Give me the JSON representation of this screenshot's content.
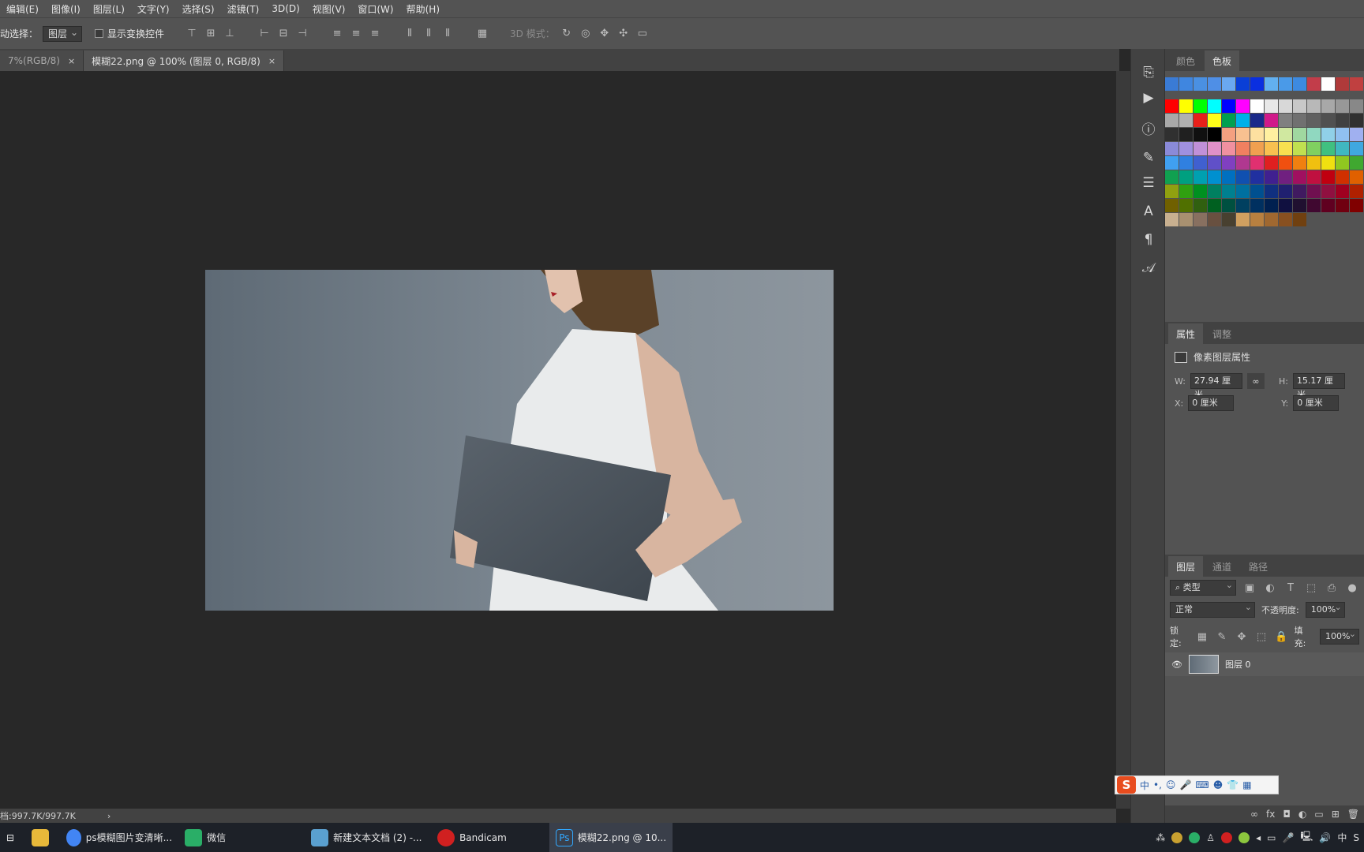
{
  "menu": [
    "编辑(E)",
    "图像(I)",
    "图层(L)",
    "文字(Y)",
    "选择(S)",
    "滤镜(T)",
    "3D(D)",
    "视图(V)",
    "窗口(W)",
    "帮助(H)"
  ],
  "options": {
    "auto_select_label": "动选择：",
    "auto_select_value": "图层",
    "show_transform_label": "显示变换控件",
    "mode_3d_label": "3D 模式："
  },
  "tabs": [
    {
      "label": "7%(RGB/8)",
      "close": "×"
    },
    {
      "label": "模糊22.png @ 100% (图层 0, RGB/8)",
      "close": "×"
    }
  ],
  "swatch_tabs": [
    "颜色",
    "色板"
  ],
  "swatches": [
    [
      "#3a7bd5",
      "#3f86e0",
      "#4a90e2",
      "#4f8fe6",
      "#6aa8f0",
      "#0a3fd6",
      "#0a2fe0",
      "#62b0f0",
      "#4a9ae8",
      "#3d8ae0",
      "#c23d4a",
      "#ffffff",
      "#b03a3a",
      "#c04040"
    ],
    [
      "#ff0000",
      "#ffff00",
      "#00ff00",
      "#00ffff",
      "#0000ff",
      "#ff00ff",
      "#ffffff",
      "#e8e8e8",
      "#d8d8d8",
      "#c8c8c8",
      "#b8b8b8",
      "#a8a8a8",
      "#989898",
      "#888888"
    ],
    [
      "#a8a8a8",
      "#b0b0b0",
      "#e8201a",
      "#ffff1a",
      "#00a050",
      "#00b0e8",
      "#1a2a8a",
      "#d01a8a",
      "#808080",
      "#707070",
      "#606060",
      "#505050",
      "#404040",
      "#303030"
    ],
    [
      "#303030",
      "#202020",
      "#101010",
      "#000000",
      "#f4a080",
      "#f8c090",
      "#fde0a0",
      "#fff0a0",
      "#d0e8a0",
      "#a0d8a0",
      "#90d8c0",
      "#90d0e8",
      "#90c0f0",
      "#a0b0f0"
    ],
    [
      "#8a8ad8",
      "#a090e0",
      "#c090d8",
      "#e090c8",
      "#f090a0",
      "#f08060",
      "#f0a050",
      "#f8c050",
      "#f8e050",
      "#c0e050",
      "#80d060",
      "#40c080",
      "#40b8c0",
      "#40a8e0"
    ],
    [
      "#40a0f0",
      "#3080e0",
      "#4060d0",
      "#6050c8",
      "#8040c0",
      "#b03890",
      "#e03070",
      "#e02020",
      "#f05010",
      "#f08010",
      "#f0c010",
      "#f0e010",
      "#90c820",
      "#40a830"
    ],
    [
      "#10a050",
      "#00a080",
      "#00a0b0",
      "#0090d0",
      "#0070c0",
      "#1050b0",
      "#2030a0",
      "#402090",
      "#702080",
      "#a01060",
      "#c01040",
      "#c00010",
      "#d03000",
      "#e06000"
    ],
    [
      "#90a010",
      "#30a010",
      "#009020",
      "#008060",
      "#008090",
      "#0070a0",
      "#005090",
      "#103080",
      "#202070",
      "#401a60",
      "#701050",
      "#901040",
      "#a00020",
      "#b02000"
    ],
    [
      "#706000",
      "#507000",
      "#306010",
      "#006020",
      "#005040",
      "#004060",
      "#003060",
      "#002050",
      "#101040",
      "#201030",
      "#400830",
      "#600020",
      "#700010",
      "#800000"
    ],
    [
      "#c8b090",
      "#a89070",
      "#887060",
      "#685040",
      "#484030",
      "#d0a060",
      "#b88040",
      "#a06830",
      "#885020",
      "#704010"
    ]
  ],
  "properties": {
    "tabs": [
      "属性",
      "调整"
    ],
    "title": "像素图层属性",
    "w_label": "W:",
    "w_value": "27.94 厘米",
    "h_label": "H:",
    "h_value": "15.17 厘米",
    "x_label": "X:",
    "x_value": "0 厘米",
    "y_label": "Y:",
    "y_value": "0 厘米"
  },
  "layers": {
    "tabs": [
      "图层",
      "通道",
      "路径"
    ],
    "filter": "类型",
    "blend": "正常",
    "opacity_label": "不透明度:",
    "opacity": "100%",
    "lock_label": "锁定:",
    "fill_label": "填充:",
    "fill": "100%",
    "layer_name": "图层 0"
  },
  "status": {
    "doc_size": "档:997.7K/997.7K",
    "arrow": "›"
  },
  "ime": {
    "mode": "中",
    "punct": "•,"
  },
  "taskbar": [
    {
      "label": "ps模糊图片变清晰...",
      "color": "#4285f4"
    },
    {
      "label": "微信",
      "color": "#2aae67"
    },
    {
      "label": "新建文本文档 (2) -...",
      "color": "#5aa0d0"
    },
    {
      "label": "Bandicam",
      "color": "#d02020"
    },
    {
      "label": "模糊22.png @ 10...",
      "color": "#0f2e4c"
    }
  ],
  "tray_ime": "中"
}
